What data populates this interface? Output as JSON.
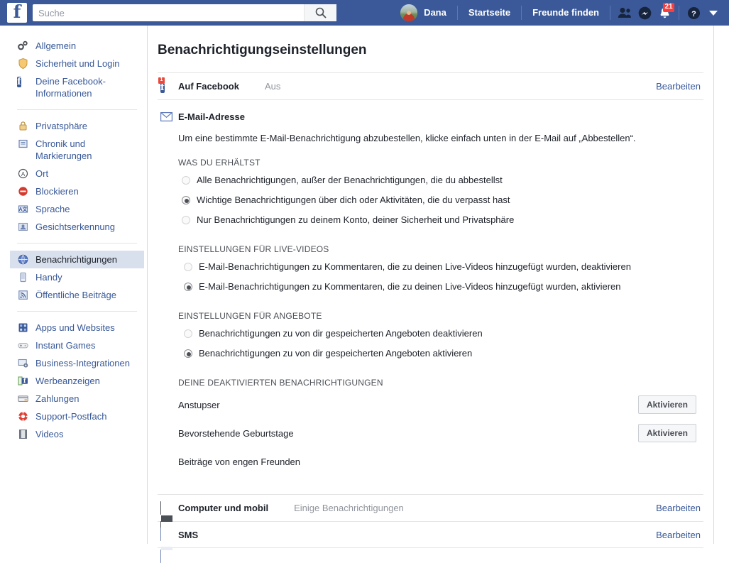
{
  "topbar": {
    "logo": "f",
    "search": {
      "placeholder": "Suche",
      "value": "",
      "icon": "search-icon"
    },
    "profile_name": "Dana",
    "links": [
      {
        "label": "Startseite",
        "name": "home-link"
      },
      {
        "label": "Freunde finden",
        "name": "find-friends-link"
      }
    ],
    "icons": [
      {
        "name": "friend-requests-icon"
      },
      {
        "name": "messenger-icon"
      },
      {
        "name": "notifications-bell-icon",
        "badge": "21"
      },
      {
        "name": "help-icon"
      },
      {
        "name": "account-menu-caret-icon"
      }
    ],
    "badge_color": "#fa3e3e",
    "bar_color": "#3b5998"
  },
  "sidebar": {
    "groups": [
      {
        "items": [
          {
            "label": "Allgemein",
            "icon": "gears-icon",
            "active": false
          },
          {
            "label": "Sicherheit und Login",
            "icon": "shield-icon",
            "active": false
          },
          {
            "label": "Deine Facebook-Informationen",
            "icon": "facebook-square-icon",
            "active": false
          }
        ]
      },
      {
        "items": [
          {
            "label": "Privatsphäre",
            "icon": "lock-icon",
            "active": false
          },
          {
            "label": "Chronik und Markierungen",
            "icon": "timeline-icon",
            "active": false
          },
          {
            "label": "Ort",
            "icon": "location-icon",
            "active": false
          },
          {
            "label": "Blockieren",
            "icon": "block-icon",
            "active": false
          },
          {
            "label": "Sprache",
            "icon": "language-icon",
            "active": false
          },
          {
            "label": "Gesichtserkennung",
            "icon": "face-recognition-icon",
            "active": false
          }
        ]
      },
      {
        "items": [
          {
            "label": "Benachrichtigungen",
            "icon": "globe-icon",
            "active": true
          },
          {
            "label": "Handy",
            "icon": "mobile-icon",
            "active": false
          },
          {
            "label": "Öffentliche Beiträge",
            "icon": "rss-icon",
            "active": false
          }
        ]
      },
      {
        "items": [
          {
            "label": "Apps und Websites",
            "icon": "apps-icon",
            "active": false
          },
          {
            "label": "Instant Games",
            "icon": "gamepad-icon",
            "active": false
          },
          {
            "label": "Business-Integrationen",
            "icon": "business-icon",
            "active": false
          },
          {
            "label": "Werbeanzeigen",
            "icon": "ads-icon",
            "active": false
          },
          {
            "label": "Zahlungen",
            "icon": "payments-card-icon",
            "active": false
          },
          {
            "label": "Support-Postfach",
            "icon": "lifebuoy-icon",
            "active": false
          },
          {
            "label": "Videos",
            "icon": "film-icon",
            "active": false
          }
        ]
      }
    ]
  },
  "main": {
    "title": "Benachrichtigungseinstellungen",
    "on_facebook": {
      "title": "Auf Facebook",
      "status": "Aus",
      "edit": "Bearbeiten",
      "icon": "facebook-notification-icon",
      "icon_badge": "1"
    },
    "email": {
      "title": "E-Mail-Adresse",
      "icon": "envelope-icon",
      "description": "Um eine bestimmte E-Mail-Benachrichtigung abzubestellen, klicke einfach unten in der E-Mail auf „Abbestellen“.",
      "sections": [
        {
          "heading": "WAS DU ERHÄLTST",
          "options": [
            {
              "label": "Alle Benachrichtigungen, außer der Benachrichtigungen, die du abbestellst",
              "selected": false
            },
            {
              "label": "Wichtige Benachrichtigungen über dich oder Aktivitäten, die du verpasst hast",
              "selected": true
            },
            {
              "label": "Nur Benachrichtigungen zu deinem Konto, deiner Sicherheit und Privatsphäre",
              "selected": false
            }
          ]
        },
        {
          "heading": "EINSTELLUNGEN FÜR LIVE-VIDEOS",
          "options": [
            {
              "label": "E-Mail-Benachrichtigungen zu Kommentaren, die zu deinen Live-Videos hinzugefügt wurden, deaktivieren",
              "selected": false
            },
            {
              "label": "E-Mail-Benachrichtigungen zu Kommentaren, die zu deinen Live-Videos hinzugefügt wurden, aktivieren",
              "selected": true
            }
          ]
        },
        {
          "heading": "EINSTELLUNGEN FÜR ANGEBOTE",
          "options": [
            {
              "label": "Benachrichtigungen zu von dir gespeicherten Angeboten deaktivieren",
              "selected": false
            },
            {
              "label": "Benachrichtigungen zu von dir gespeicherten Angeboten aktivieren",
              "selected": true
            }
          ]
        }
      ],
      "disabled_heading": "DEINE DEAKTIVIERTEN BENACHRICHTIGUNGEN",
      "disabled_items": [
        {
          "name": "Anstupser",
          "button": "Aktivieren"
        },
        {
          "name": "Bevorstehende Geburtstage",
          "button": "Aktivieren"
        },
        {
          "name": "Beiträge von engen Freunden",
          "button": ""
        }
      ]
    },
    "bottom_rows": [
      {
        "title": "Computer und mobil",
        "status": "Einige Benachrichtigungen",
        "edit": "Bearbeiten",
        "icon": "desktop-mobile-icon"
      },
      {
        "title": "SMS",
        "status": "",
        "edit": "Bearbeiten",
        "icon": "sms-icon"
      }
    ]
  }
}
